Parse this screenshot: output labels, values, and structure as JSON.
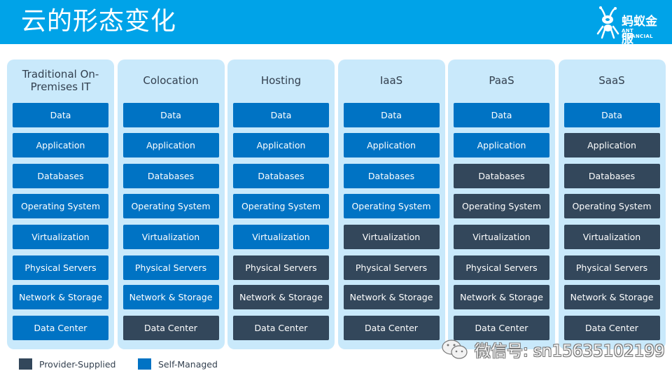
{
  "header": {
    "title": "云的形态变化",
    "logo": {
      "name_cn": "蚂蚁金服",
      "name_en": "ANT FINANCIAL",
      "icon": "ant-icon"
    }
  },
  "colors": {
    "header_bg": "#00a3e8",
    "column_bg": "#c9e9fb",
    "self_managed": "#0073c4",
    "provider_supplied": "#33475b"
  },
  "layers": [
    "Data",
    "Application",
    "Databases",
    "Operating System",
    "Virtualization",
    "Physical Servers",
    "Network & Storage",
    "Data Center"
  ],
  "columns": [
    {
      "title": "Traditional On-Premises IT",
      "provider_supplied_from_layer": 8,
      "blocks": [
        {
          "label": "Data",
          "type": "self"
        },
        {
          "label": "Application",
          "type": "self"
        },
        {
          "label": "Databases",
          "type": "self"
        },
        {
          "label": "Operating System",
          "type": "self"
        },
        {
          "label": "Virtualization",
          "type": "self"
        },
        {
          "label": "Physical Servers",
          "type": "self"
        },
        {
          "label": "Network & Storage",
          "type": "self"
        },
        {
          "label": "Data Center",
          "type": "self"
        }
      ]
    },
    {
      "title": "Colocation",
      "blocks": [
        {
          "label": "Data",
          "type": "self"
        },
        {
          "label": "Application",
          "type": "self"
        },
        {
          "label": "Databases",
          "type": "self"
        },
        {
          "label": "Operating System",
          "type": "self"
        },
        {
          "label": "Virtualization",
          "type": "self"
        },
        {
          "label": "Physical Servers",
          "type": "self"
        },
        {
          "label": "Network & Storage",
          "type": "self"
        },
        {
          "label": "Data Center",
          "type": "provider"
        }
      ]
    },
    {
      "title": "Hosting",
      "blocks": [
        {
          "label": "Data",
          "type": "self"
        },
        {
          "label": "Application",
          "type": "self"
        },
        {
          "label": "Databases",
          "type": "self"
        },
        {
          "label": "Operating System",
          "type": "self"
        },
        {
          "label": "Virtualization",
          "type": "self"
        },
        {
          "label": "Physical Servers",
          "type": "provider"
        },
        {
          "label": "Network & Storage",
          "type": "provider"
        },
        {
          "label": "Data Center",
          "type": "provider"
        }
      ]
    },
    {
      "title": "IaaS",
      "blocks": [
        {
          "label": "Data",
          "type": "self"
        },
        {
          "label": "Application",
          "type": "self"
        },
        {
          "label": "Databases",
          "type": "self"
        },
        {
          "label": "Operating System",
          "type": "self"
        },
        {
          "label": "Virtualization",
          "type": "provider"
        },
        {
          "label": "Physical Servers",
          "type": "provider"
        },
        {
          "label": "Network & Storage",
          "type": "provider"
        },
        {
          "label": "Data Center",
          "type": "provider"
        }
      ]
    },
    {
      "title": "PaaS",
      "blocks": [
        {
          "label": "Data",
          "type": "self"
        },
        {
          "label": "Application",
          "type": "self"
        },
        {
          "label": "Databases",
          "type": "provider"
        },
        {
          "label": "Operating System",
          "type": "provider"
        },
        {
          "label": "Virtualization",
          "type": "provider"
        },
        {
          "label": "Physical Servers",
          "type": "provider"
        },
        {
          "label": "Network & Storage",
          "type": "provider"
        },
        {
          "label": "Data Center",
          "type": "provider"
        }
      ]
    },
    {
      "title": "SaaS",
      "blocks": [
        {
          "label": "Data",
          "type": "self"
        },
        {
          "label": "Application",
          "type": "provider"
        },
        {
          "label": "Databases",
          "type": "provider"
        },
        {
          "label": "Operating System",
          "type": "provider"
        },
        {
          "label": "Virtualization",
          "type": "provider"
        },
        {
          "label": "Physical Servers",
          "type": "provider"
        },
        {
          "label": "Network & Storage",
          "type": "provider"
        },
        {
          "label": "Data Center",
          "type": "provider"
        }
      ]
    }
  ],
  "legend": {
    "provider": "Provider-Supplied",
    "self": "Self-Managed"
  },
  "watermark": {
    "icon": "wechat-icon",
    "text": "微信号: sn15635102199"
  }
}
